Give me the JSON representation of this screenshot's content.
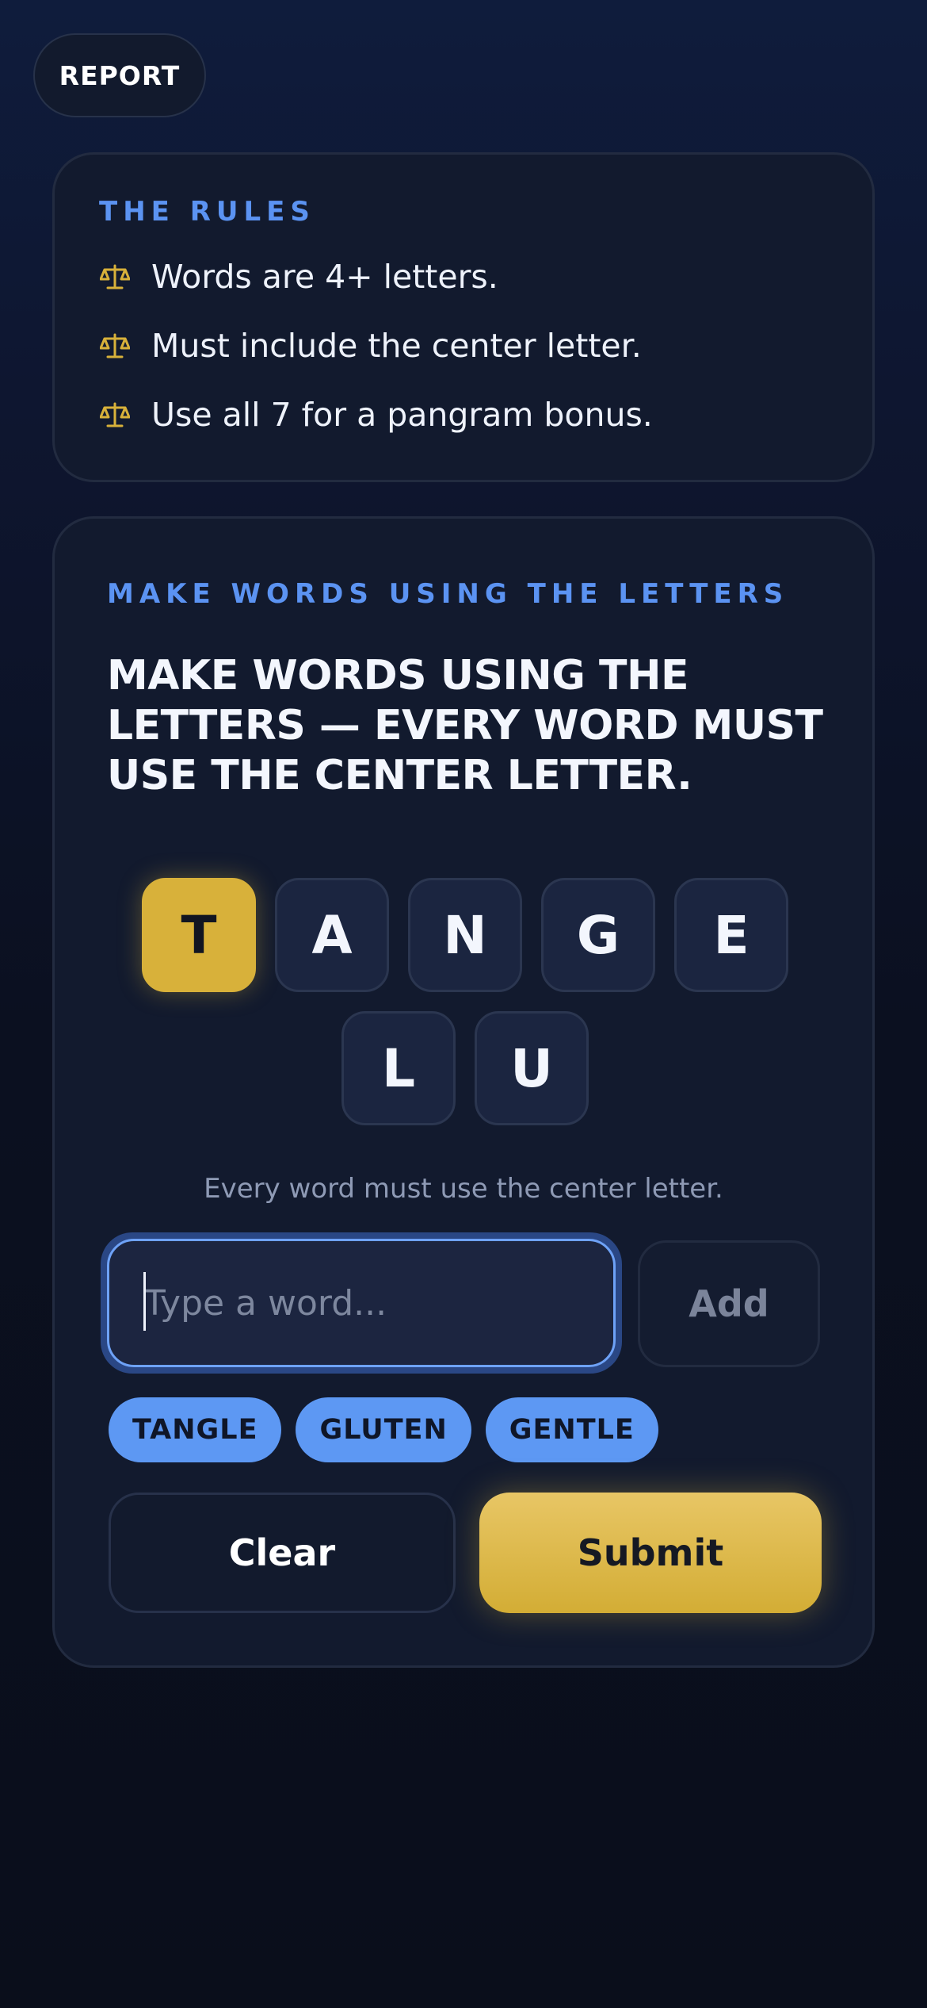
{
  "header": {
    "report_label": "REPORT"
  },
  "rules": {
    "heading": "THE RULES",
    "bullet_icon": "scales-icon",
    "bullet_color": "#d8b13a",
    "items": [
      "Words are 4+ letters.",
      "Must include the center letter.",
      "Use all 7 for a pangram bonus."
    ]
  },
  "game": {
    "label": "MAKE WORDS USING THE LETTERS",
    "headline": "MAKE WORDS USING THE LETTERS — EVERY WORD MUST USE THE CENTER LETTER.",
    "center_letter": "T",
    "outer_letters": [
      "A",
      "N",
      "G",
      "E",
      "L",
      "U"
    ],
    "hint": "Every word must use the center letter.",
    "input": {
      "placeholder": "Type a word...",
      "value": ""
    },
    "add_label": "Add",
    "found_words": [
      "TANGLE",
      "GLUTEN",
      "GENTLE"
    ],
    "clear_label": "Clear",
    "submit_label": "Submit"
  },
  "colors": {
    "accent_blue": "#5b93f2",
    "accent_gold": "#d8b13a",
    "background": "#0b1020"
  }
}
